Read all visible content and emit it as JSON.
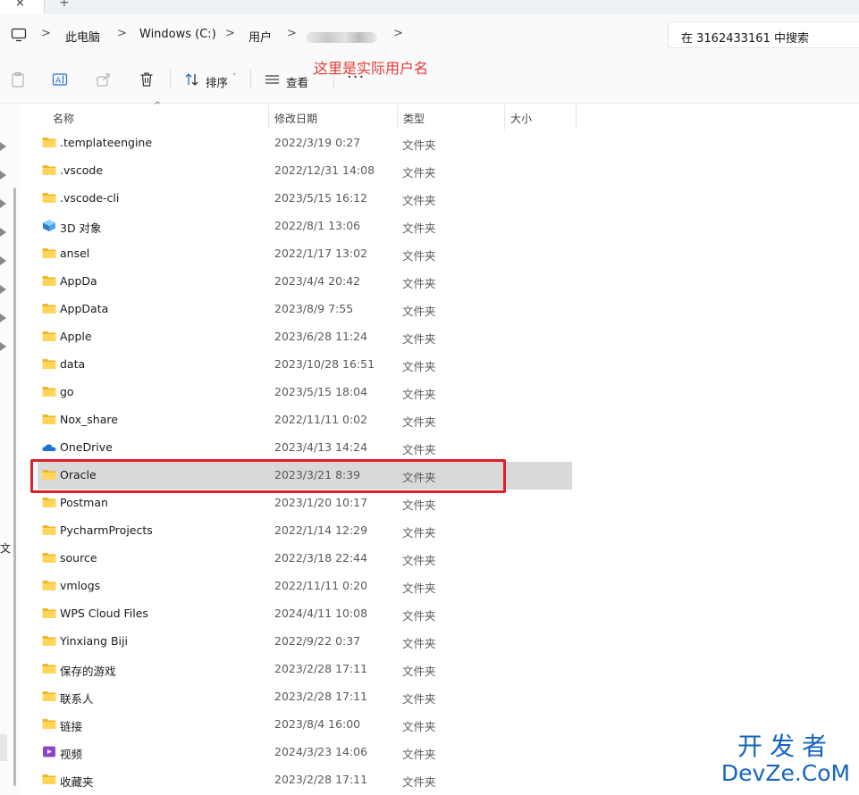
{
  "tab": {
    "close_glyph": "×",
    "new_tab_glyph": "+"
  },
  "breadcrumb": {
    "items": [
      "此电脑",
      "Windows (C:)",
      "用户"
    ],
    "separator_glyph": ">"
  },
  "search": {
    "placeholder": "在 3162433161 中搜索"
  },
  "toolbar": {
    "sort_label": "排序",
    "view_label": "查看",
    "more_label": "···",
    "caret_glyph": "˅",
    "icons": [
      "paste-icon",
      "rename-icon",
      "share-icon",
      "delete-icon",
      "sort-icon",
      "view-icon"
    ]
  },
  "annotation": {
    "text": "这里是实际用户名",
    "color": "#e53935"
  },
  "sidebar": {
    "partial_text": "文"
  },
  "columns": {
    "name": "名称",
    "date": "修改日期",
    "type": "类型",
    "size": "大小",
    "sort_indicator": "^"
  },
  "files": [
    {
      "name": ".templateengine",
      "date": "2022/3/19 0:27",
      "type": "文件夹",
      "icon": "folder-icon"
    },
    {
      "name": ".vscode",
      "date": "2022/12/31 14:08",
      "type": "文件夹",
      "icon": "folder-icon"
    },
    {
      "name": ".vscode-cli",
      "date": "2023/5/15 16:12",
      "type": "文件夹",
      "icon": "folder-icon"
    },
    {
      "name": "3D 对象",
      "date": "2022/8/1 13:06",
      "type": "文件夹",
      "icon": "3d-objects-icon"
    },
    {
      "name": "ansel",
      "date": "2022/1/17 13:02",
      "type": "文件夹",
      "icon": "folder-icon"
    },
    {
      "name": "AppDa",
      "date": "2023/4/4 20:42",
      "type": "文件夹",
      "icon": "folder-icon"
    },
    {
      "name": "AppData",
      "date": "2023/8/9 7:55",
      "type": "文件夹",
      "icon": "folder-icon"
    },
    {
      "name": "Apple",
      "date": "2023/6/28 11:24",
      "type": "文件夹",
      "icon": "folder-icon"
    },
    {
      "name": "data",
      "date": "2023/10/28 16:51",
      "type": "文件夹",
      "icon": "folder-icon"
    },
    {
      "name": "go",
      "date": "2023/5/15 18:04",
      "type": "文件夹",
      "icon": "folder-icon"
    },
    {
      "name": "Nox_share",
      "date": "2022/11/11 0:02",
      "type": "文件夹",
      "icon": "folder-icon"
    },
    {
      "name": "OneDrive",
      "date": "2023/4/13 14:24",
      "type": "文件夹",
      "icon": "onedrive-icon"
    },
    {
      "name": "Oracle",
      "date": "2023/3/21 8:39",
      "type": "文件夹",
      "icon": "folder-icon",
      "selected": true
    },
    {
      "name": "Postman",
      "date": "2023/1/20 10:17",
      "type": "文件夹",
      "icon": "folder-icon"
    },
    {
      "name": "PycharmProjects",
      "date": "2022/1/14 12:29",
      "type": "文件夹",
      "icon": "folder-icon"
    },
    {
      "name": "source",
      "date": "2022/3/18 22:44",
      "type": "文件夹",
      "icon": "folder-icon"
    },
    {
      "name": "vmlogs",
      "date": "2022/11/11 0:20",
      "type": "文件夹",
      "icon": "folder-icon"
    },
    {
      "name": "WPS Cloud Files",
      "date": "2024/4/11 10:08",
      "type": "文件夹",
      "icon": "folder-icon"
    },
    {
      "name": "Yinxiang Biji",
      "date": "2022/9/22 0:37",
      "type": "文件夹",
      "icon": "folder-icon"
    },
    {
      "name": "保存的游戏",
      "date": "2023/2/28 17:11",
      "type": "文件夹",
      "icon": "folder-icon"
    },
    {
      "name": "联系人",
      "date": "2023/2/28 17:11",
      "type": "文件夹",
      "icon": "folder-icon"
    },
    {
      "name": "链接",
      "date": "2023/8/4 16:00",
      "type": "文件夹",
      "icon": "folder-icon"
    },
    {
      "name": "视频",
      "date": "2024/3/23 14:06",
      "type": "文件夹",
      "icon": "videos-icon"
    },
    {
      "name": "收藏夹",
      "date": "2023/2/28 17:11",
      "type": "文件夹",
      "icon": "folder-icon"
    }
  ],
  "watermark": {
    "line1": "开发者",
    "line2": "DevZe.CoM",
    "color": "#1565c0"
  }
}
